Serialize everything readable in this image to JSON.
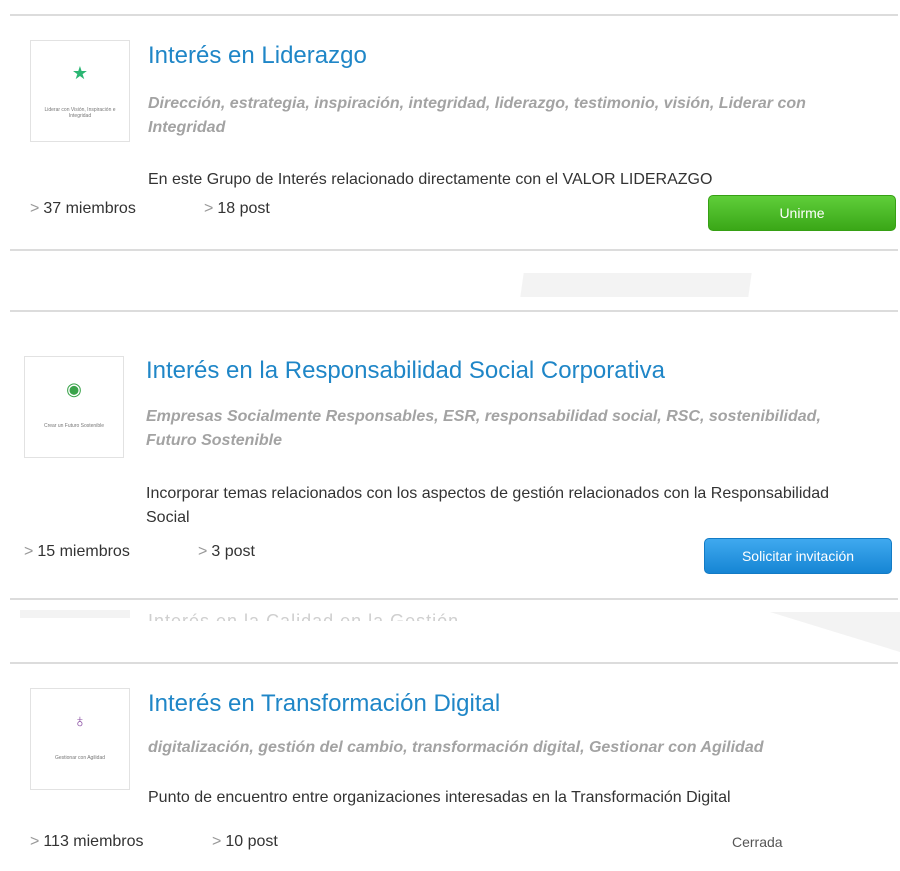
{
  "groups": [
    {
      "title": "Interés en Liderazgo",
      "tags": "Dirección, estrategia, inspiración, integridad, liderazgo, testimonio, visión, Liderar con Integridad",
      "description": "En este Grupo de Interés relacionado directamente con el VALOR LIDERAZGO",
      "members": "37 miembros",
      "posts": "18 post",
      "action": "Unirme",
      "thumb_icon": "★",
      "thumb_caption": "Liderar con Visión, Inspiración e Integridad",
      "accent": "#2bb673"
    },
    {
      "title": "Interés en la Responsabilidad Social Corporativa",
      "tags": "Empresas Socialmente Responsables, ESR, responsabilidad social, RSC, sostenibilidad, Futuro Sostenible",
      "description": "Incorporar temas relacionados con los aspectos de gestión relacionados con la Responsabilidad Social",
      "members": "15 miembros",
      "posts": "3 post",
      "action": "Solicitar invitación",
      "thumb_icon": "◉",
      "thumb_caption": "Crear un Futuro Sostenible",
      "accent": "#3aa34a"
    },
    {
      "title": "Interés en Transformación Digital",
      "tags": "digitalización, gestión del cambio, transformación digital, Gestionar con Agilidad",
      "description": "Punto de encuentro entre organizaciones interesadas en la Transformación Digital",
      "members": "113 miembros",
      "posts": "10 post",
      "status": "Cerrada",
      "thumb_icon": "♁",
      "thumb_caption": "Gestionar con Agilidad",
      "accent": "#8a4fa3"
    }
  ],
  "partial_text": "Interés en la Calidad en la Gestión",
  "chevron": ">"
}
